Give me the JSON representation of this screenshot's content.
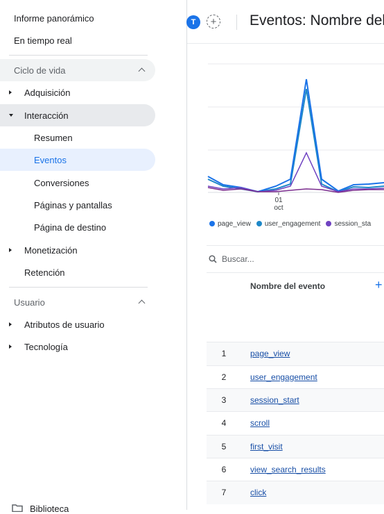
{
  "sidebar": {
    "top_items": [
      {
        "label": "Informe panorámico"
      },
      {
        "label": "En tiempo real"
      }
    ],
    "sections": [
      {
        "title": "Ciclo de vida"
      },
      {
        "title": "Usuario"
      }
    ],
    "lifecycle": {
      "adquisicion": "Adquisición",
      "interaccion": "Interacción",
      "sub": [
        "Resumen",
        "Eventos",
        "Conversiones",
        "Páginas y pantallas",
        "Página de destino"
      ],
      "monetizacion": "Monetización",
      "retencion": "Retención"
    },
    "user": {
      "atributos": "Atributos de usuario",
      "tecnologia": "Tecnología"
    },
    "library": "Biblioteca"
  },
  "header": {
    "avatar_letter": "T",
    "title": "Eventos: Nombre del e"
  },
  "chart_data": {
    "type": "line",
    "x_tick_labels": [
      {
        "day": "01",
        "month": "oct"
      }
    ],
    "series": [
      {
        "name": "page_view",
        "color": "#1a73e8"
      },
      {
        "name": "user_engagement",
        "color": "#1e88c8"
      },
      {
        "name": "session_sta",
        "color": "#6f42c1"
      }
    ]
  },
  "search": {
    "placeholder": "Buscar..."
  },
  "table": {
    "column_header": "Nombre del evento",
    "rows": [
      {
        "n": "1",
        "event": "page_view"
      },
      {
        "n": "2",
        "event": "user_engagement"
      },
      {
        "n": "3",
        "event": "session_start"
      },
      {
        "n": "4",
        "event": "scroll"
      },
      {
        "n": "5",
        "event": "first_visit"
      },
      {
        "n": "6",
        "event": "view_search_results"
      },
      {
        "n": "7",
        "event": "click"
      }
    ]
  },
  "colors": {
    "accent": "#1a73e8",
    "selected_bg": "#e8f0fe",
    "expanded_bg": "#e8eaed"
  }
}
